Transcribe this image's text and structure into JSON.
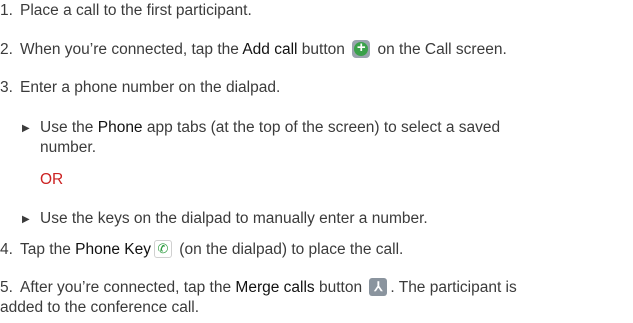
{
  "steps": [
    {
      "num": "1.",
      "text": "Place a call to the first participant."
    },
    {
      "num": "2.",
      "pre": "When you’re connected, tap the ",
      "bold": "Add call",
      "mid": " button ",
      "icon": "add-circle-icon",
      "post": " on the Call screen."
    },
    {
      "num": "3.",
      "text": "Enter a phone number on the dialpad."
    },
    {
      "num": "4.",
      "pre": "Tap the ",
      "bold": "Phone Key",
      "icon": "phone-handset-icon",
      "post": " (on the dialpad) to place the call."
    },
    {
      "num": "5.",
      "pre": "After you’re connected, tap the ",
      "bold": "Merge calls",
      "mid": " button ",
      "icon": "merge-calls-icon",
      "post": ". The participant is",
      "line2": "added to the conference call."
    }
  ],
  "substeps": [
    {
      "pre": "Use the ",
      "bold": "Phone",
      "post": " app tabs (at the top of the screen) to select a saved",
      "line2": "number."
    },
    {
      "text": "Use the keys on the dialpad to manually enter a number."
    }
  ],
  "or_label": "OR",
  "colors": {
    "text": "#3b3b3b",
    "accent_or": "#cc2222",
    "add_green": "#3aa14a"
  }
}
